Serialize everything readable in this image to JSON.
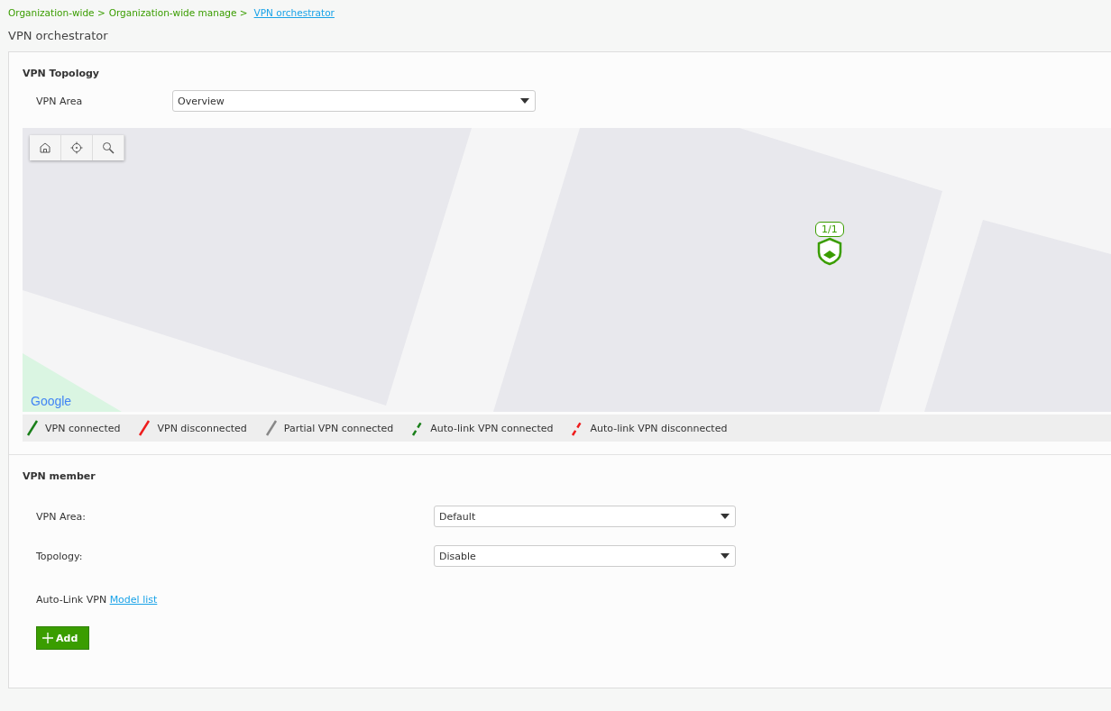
{
  "breadcrumb": {
    "items": [
      "Organization-wide >",
      "Organization-wide manage >"
    ],
    "current": "VPN orchestrator"
  },
  "page_title": "VPN orchestrator",
  "topology": {
    "title": "VPN Topology",
    "area_label": "VPN Area",
    "area_value": "Overview",
    "map": {
      "marker_count": "1/1",
      "attribution": "Google"
    },
    "legend": [
      {
        "label": "VPN connected",
        "color": "#1a7f1a",
        "kind": "solid"
      },
      {
        "label": "VPN disconnected",
        "color": "#ee1c1c",
        "kind": "solid"
      },
      {
        "label": "Partial VPN connected",
        "color": "#888888",
        "kind": "solid"
      },
      {
        "label": "Auto-link VPN connected",
        "color": "#1a7f1a",
        "kind": "dashed"
      },
      {
        "label": "Auto-link VPN disconnected",
        "color": "#ee1c1c",
        "kind": "dashed"
      }
    ]
  },
  "member": {
    "title": "VPN member",
    "fields": [
      {
        "label": "VPN Area:",
        "value": "Default"
      },
      {
        "label": "Topology:",
        "value": "Disable"
      }
    ],
    "autolink_label": "Auto-Link VPN",
    "autolink_link": "Model list",
    "add_button": "Add"
  }
}
